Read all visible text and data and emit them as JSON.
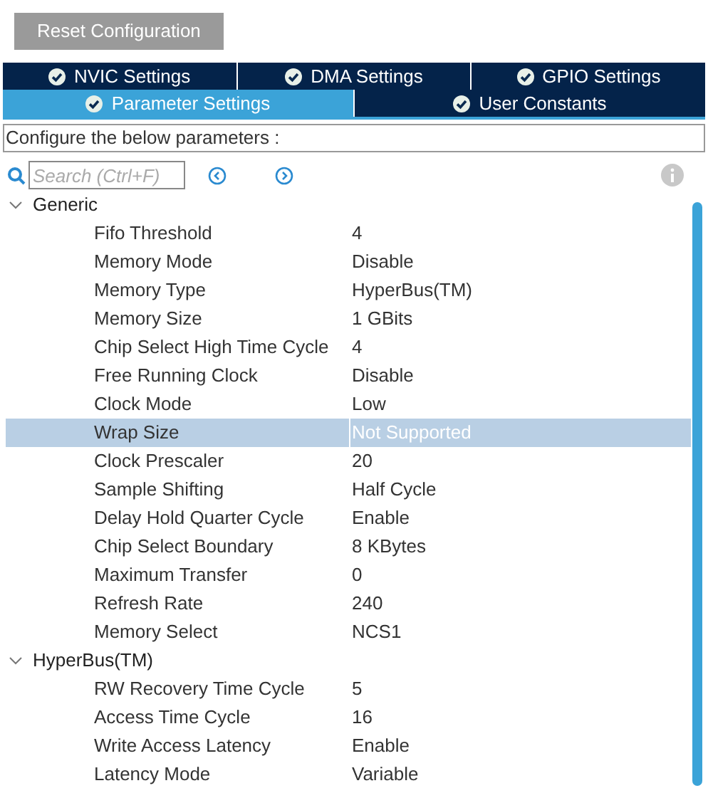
{
  "reset_button": "Reset Configuration",
  "tabs_top": [
    {
      "label": "NVIC Settings",
      "selected": false
    },
    {
      "label": "DMA Settings",
      "selected": false
    },
    {
      "label": "GPIO Settings",
      "selected": false
    }
  ],
  "tabs_bottom": [
    {
      "label": "Parameter Settings",
      "selected": true
    },
    {
      "label": "User Constants",
      "selected": false
    }
  ],
  "description": "Configure the below parameters :",
  "search": {
    "placeholder": "Search (Ctrl+F)"
  },
  "groups": [
    {
      "label": "Generic",
      "expanded": true,
      "children": [
        {
          "name": "Fifo Threshold",
          "value": "4",
          "selected": false
        },
        {
          "name": "Memory Mode",
          "value": "Disable",
          "selected": false
        },
        {
          "name": "Memory Type",
          "value": "HyperBus(TM)",
          "selected": false
        },
        {
          "name": "Memory Size",
          "value": "1 GBits",
          "selected": false
        },
        {
          "name": "Chip Select High Time Cycle",
          "value": "4",
          "selected": false
        },
        {
          "name": "Free Running Clock",
          "value": "Disable",
          "selected": false
        },
        {
          "name": "Clock Mode",
          "value": "Low",
          "selected": false
        },
        {
          "name": "Wrap Size",
          "value": "Not Supported",
          "selected": true
        },
        {
          "name": "Clock Prescaler",
          "value": "20",
          "selected": false
        },
        {
          "name": "Sample Shifting",
          "value": "Half Cycle",
          "selected": false
        },
        {
          "name": "Delay Hold Quarter Cycle",
          "value": "Enable",
          "selected": false
        },
        {
          "name": "Chip Select Boundary",
          "value": "8 KBytes",
          "selected": false
        },
        {
          "name": "Maximum Transfer",
          "value": "0",
          "selected": false
        },
        {
          "name": "Refresh Rate",
          "value": "240",
          "selected": false
        },
        {
          "name": "Memory Select",
          "value": "NCS1",
          "selected": false
        }
      ]
    },
    {
      "label": "HyperBus(TM)",
      "expanded": true,
      "children": [
        {
          "name": "RW Recovery Time Cycle",
          "value": "5",
          "selected": false
        },
        {
          "name": "Access Time Cycle",
          "value": "16",
          "selected": false
        },
        {
          "name": "Write Access Latency",
          "value": "Enable",
          "selected": false
        },
        {
          "name": "Latency Mode",
          "value": "Variable",
          "selected": false
        }
      ]
    }
  ]
}
